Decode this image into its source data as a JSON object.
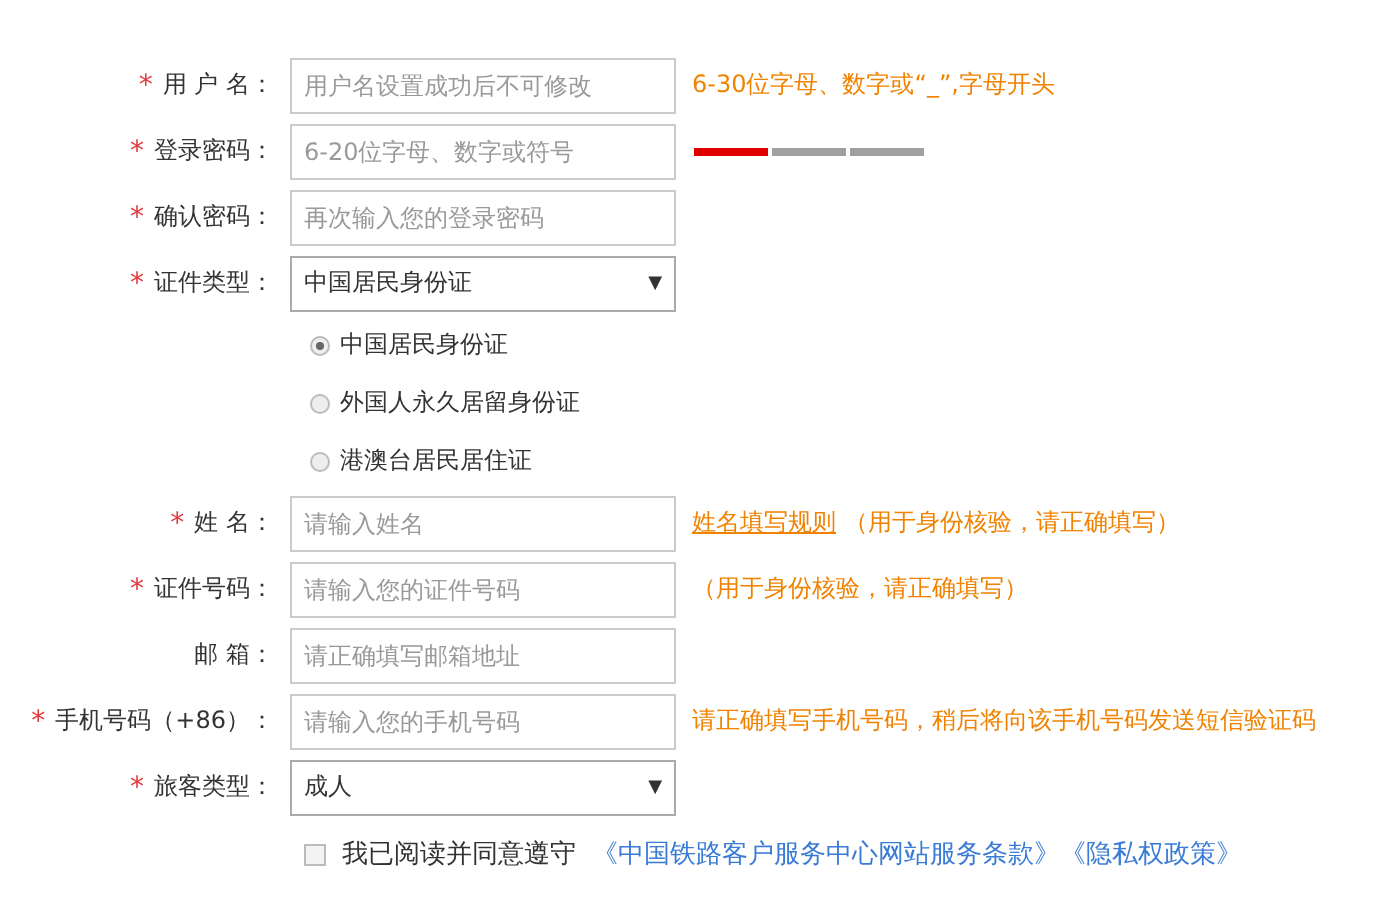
{
  "form": {
    "rows": [
      {
        "kind": "input",
        "mark": "*",
        "label": "用 户 名：",
        "placeholder": "用户名设置成功后不可修改",
        "hint": "6-30位字母、数字或“_”,字母开头"
      },
      {
        "kind": "password",
        "mark": "*",
        "label": "登录密码：",
        "placeholder": "6-20位字母、数字或符号",
        "strength": {
          "level": 0.33
        }
      },
      {
        "kind": "input",
        "mark": "*",
        "label": "确认密码：",
        "placeholder": "再次输入您的登录密码"
      },
      {
        "kind": "select",
        "mark": "*",
        "label": "证件类型：",
        "value": "中国居民身份证",
        "caret": "▼"
      },
      {
        "kind": "radio",
        "label": "中国居民身份证",
        "selected": true
      },
      {
        "kind": "radio",
        "label": "外国人永久居留身份证",
        "selected": false
      },
      {
        "kind": "radio",
        "label": "港澳台居民居住证",
        "selected": false
      },
      {
        "kind": "input",
        "mark": "*",
        "label": "姓 名：",
        "placeholder": "请输入姓名",
        "hint_link": "姓名填写规则",
        "hint": "（用于身份核验，请正确填写）"
      },
      {
        "kind": "input",
        "mark": "*",
        "label": "证件号码：",
        "placeholder": "请输入您的证件号码",
        "hint": "（用于身份核验，请正确填写）"
      },
      {
        "kind": "input",
        "label": "邮 箱：",
        "placeholder": "请正确填写邮箱地址"
      },
      {
        "kind": "input",
        "mark": "*",
        "label": "手机号码（+86）：",
        "placeholder": "请输入您的手机号码",
        "hint": "请正确填写手机号码，稍后将向该手机号码发送短信验证码"
      },
      {
        "kind": "select",
        "mark": "*",
        "label": "旅客类型：",
        "value": "成人",
        "caret": "▼"
      }
    ]
  },
  "agreement": {
    "checked": false,
    "text": "我已阅读并同意遵守",
    "links": [
      "《中国铁路客户服务中心网站服务条款》",
      "《隐私权政策》"
    ]
  }
}
